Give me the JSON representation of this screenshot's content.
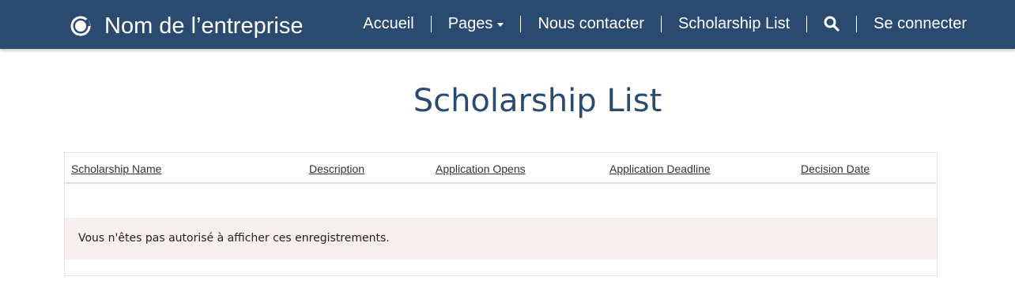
{
  "header": {
    "brand_name": "Nom de l’entreprise",
    "logo_icon": "company-logo-ring",
    "nav": {
      "home": "Accueil",
      "pages": "Pages",
      "contact": "Nous contacter",
      "scholarships": "Scholarship List",
      "search_icon": "search-icon",
      "signin": "Se connecter"
    },
    "background_color": "#2b4a6f"
  },
  "main": {
    "title": "Scholarship List",
    "table": {
      "columns": [
        "Scholarship Name",
        "Description",
        "Application Opens",
        "Application Deadline",
        "Decision Date"
      ],
      "rows": [],
      "notice": "Vous n'êtes pas autorisé à afficher ces enregistrements."
    }
  },
  "colors": {
    "accent": "#2b4a6f",
    "notice_background": "#f7efee"
  }
}
